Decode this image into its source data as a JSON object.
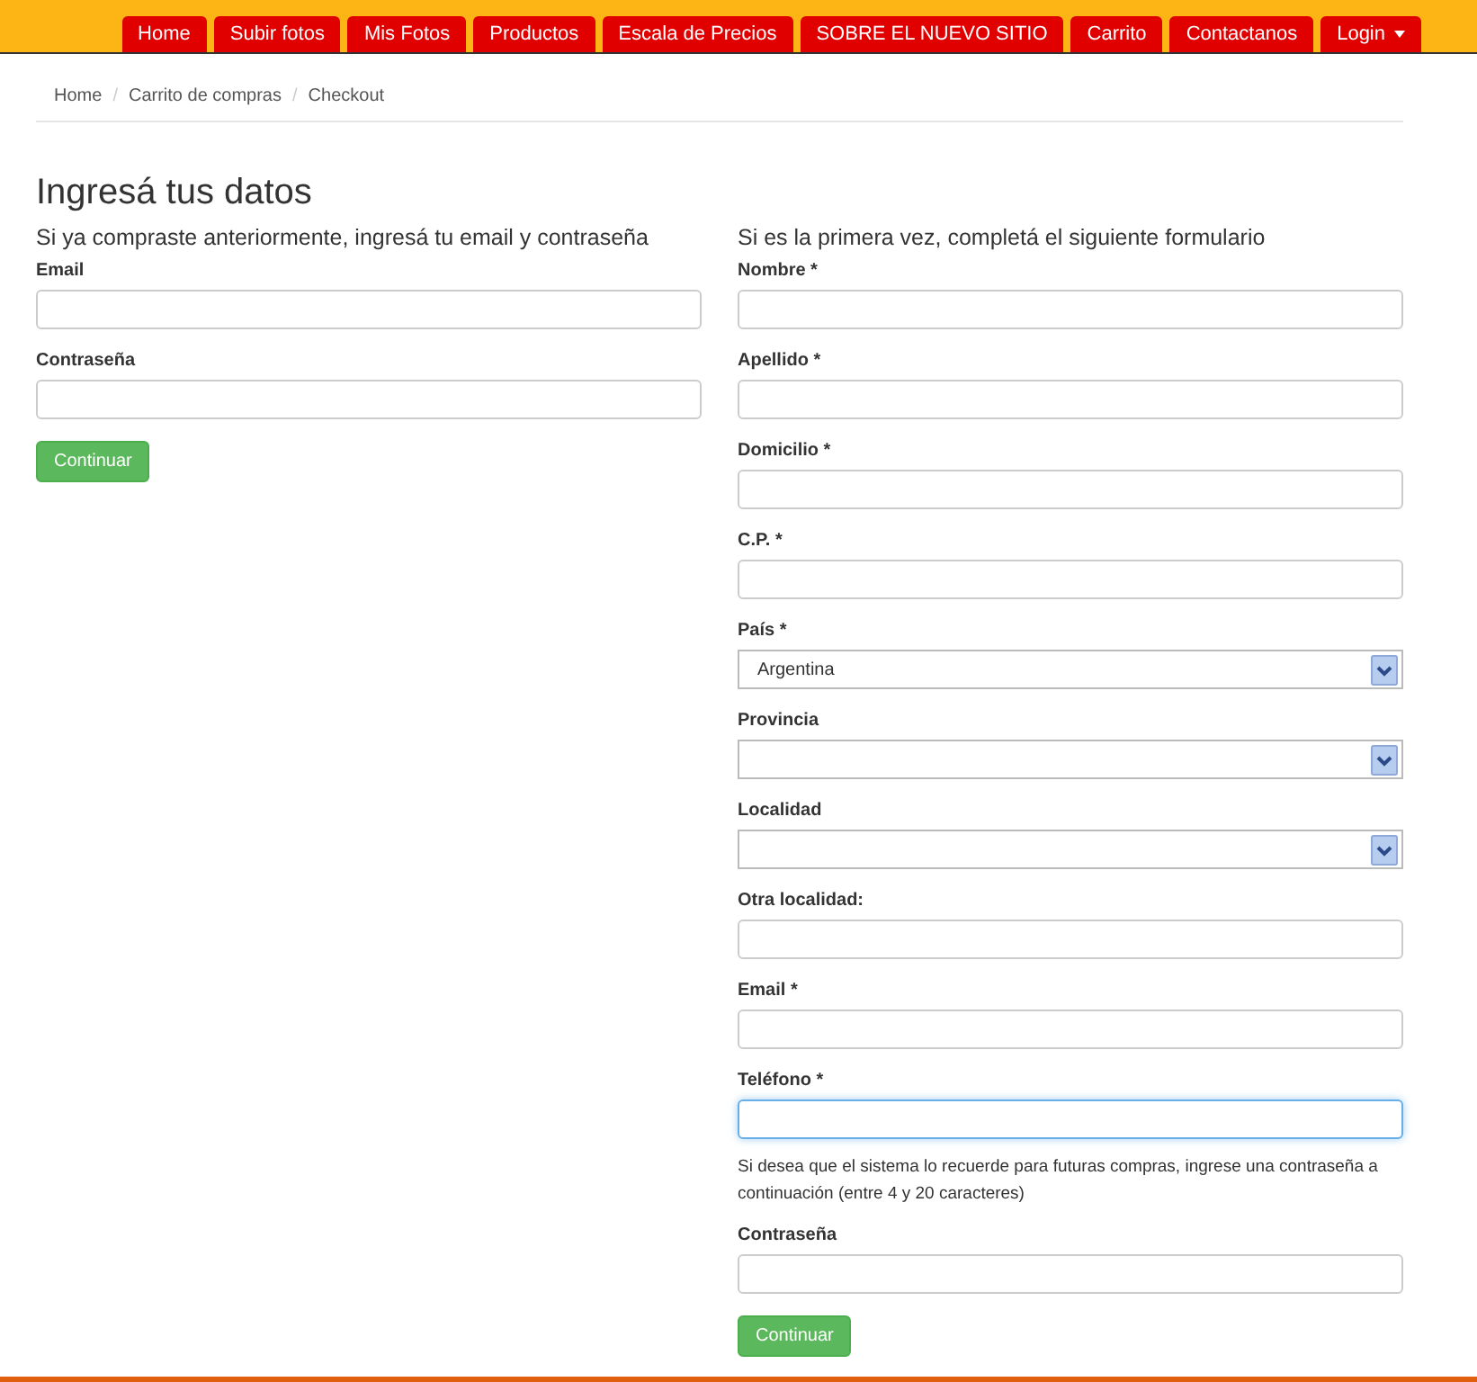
{
  "nav": [
    {
      "label": "Home",
      "dropdown": false
    },
    {
      "label": "Subir fotos",
      "dropdown": false
    },
    {
      "label": "Mis Fotos",
      "dropdown": false
    },
    {
      "label": "Productos",
      "dropdown": false
    },
    {
      "label": "Escala de Precios",
      "dropdown": false
    },
    {
      "label": "SOBRE EL NUEVO SITIO",
      "dropdown": false
    },
    {
      "label": "Carrito",
      "dropdown": false
    },
    {
      "label": "Contactanos",
      "dropdown": false
    },
    {
      "label": "Login",
      "dropdown": true
    }
  ],
  "breadcrumb": [
    "Home",
    "Carrito de compras",
    "Checkout"
  ],
  "breadcrumb_separator": "/",
  "title": "Ingresá tus datos",
  "login": {
    "heading": "Si ya compraste anteriormente, ingresá tu email y contraseña",
    "fields": [
      {
        "kind": "text",
        "label": "Email",
        "focused": false
      },
      {
        "kind": "text",
        "label": "Contraseña",
        "focused": false
      }
    ],
    "button": "Continuar"
  },
  "register": {
    "heading": "Si es la primera vez, completá el siguiente formulario",
    "fields": [
      {
        "kind": "text",
        "label": "Nombre *",
        "focused": false
      },
      {
        "kind": "text",
        "label": "Apellido *",
        "focused": false
      },
      {
        "kind": "text",
        "label": "Domicilio *",
        "focused": false
      },
      {
        "kind": "text",
        "label": "C.P. *",
        "focused": false
      },
      {
        "kind": "select",
        "label": "País *",
        "value": "Argentina"
      },
      {
        "kind": "select",
        "label": "Provincia"
      },
      {
        "kind": "select",
        "label": "Localidad"
      },
      {
        "kind": "text",
        "label": "Otra localidad:",
        "focused": false
      },
      {
        "kind": "text",
        "label": "Email *",
        "focused": false
      },
      {
        "kind": "text",
        "label": "Teléfono *",
        "focused": true
      },
      {
        "kind": "note",
        "text": "Si desea que el sistema lo recuerde para futuras compras, ingrese una contraseña a continuación (entre 4 y 20 caracteres)"
      },
      {
        "kind": "text",
        "label": "Contraseña",
        "focused": false
      }
    ],
    "button": "Continuar"
  }
}
